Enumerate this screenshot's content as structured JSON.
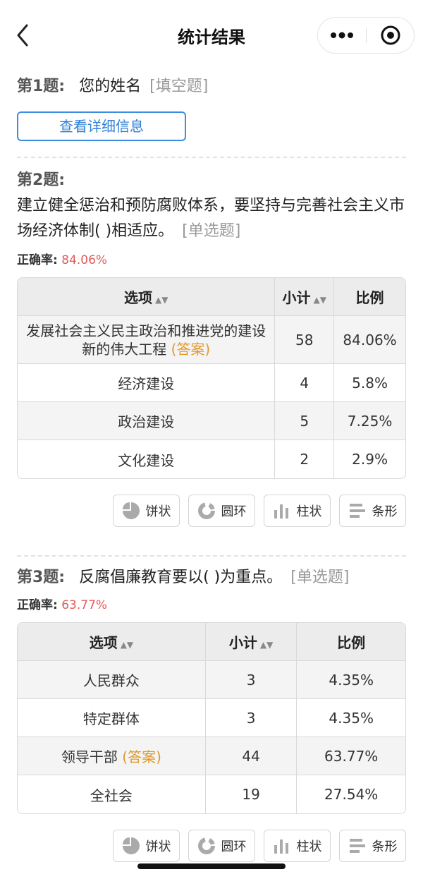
{
  "header": {
    "title": "统计结果"
  },
  "q1": {
    "num": "第1题:",
    "title": "您的姓名",
    "type": "[填空题]",
    "detail_btn": "查看详细信息"
  },
  "q2": {
    "num": "第2题:",
    "title": "建立健全惩治和预防腐败体系，要坚持与完善社会主义市场经济体制( )相适应。",
    "type": "[单选题]",
    "accuracy_label": "正确率:",
    "accuracy": "84.06%",
    "columns": [
      "选项",
      "小计",
      "比例"
    ],
    "rows": [
      {
        "option": "发展社会主义民主政治和推进党的建设新的伟大工程",
        "answer_tag": "(答案)",
        "count": "58",
        "ratio": "84.06%"
      },
      {
        "option": "经济建设",
        "count": "4",
        "ratio": "5.8%"
      },
      {
        "option": "政治建设",
        "count": "5",
        "ratio": "7.25%"
      },
      {
        "option": "文化建设",
        "count": "2",
        "ratio": "2.9%"
      }
    ]
  },
  "q3": {
    "num": "第3题:",
    "title": "反腐倡廉教育要以( )为重点。",
    "type": "[单选题]",
    "accuracy_label": "正确率:",
    "accuracy": "63.77%",
    "columns": [
      "选项",
      "小计",
      "比例"
    ],
    "rows": [
      {
        "option": "人民群众",
        "count": "3",
        "ratio": "4.35%"
      },
      {
        "option": "特定群体",
        "count": "3",
        "ratio": "4.35%"
      },
      {
        "option": "领导干部",
        "answer_tag": "(答案)",
        "count": "44",
        "ratio": "63.77%"
      },
      {
        "option": "全社会",
        "count": "19",
        "ratio": "27.54%"
      }
    ]
  },
  "chart_buttons": [
    "饼状",
    "圆环",
    "柱状",
    "条形"
  ],
  "colors": {
    "accent": "#3d8ee0",
    "accuracy": "#e35a5a",
    "answer": "#e0992a"
  }
}
